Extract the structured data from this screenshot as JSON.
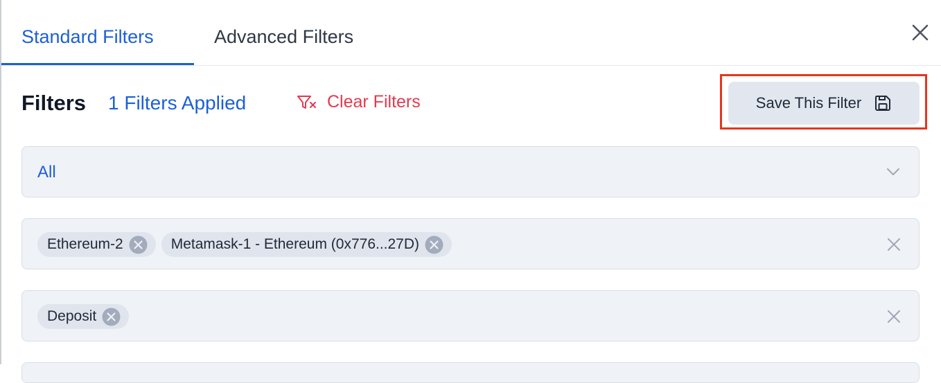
{
  "tabs": [
    {
      "label": "Standard Filters",
      "active": true
    },
    {
      "label": "Advanced Filters",
      "active": false
    }
  ],
  "header": {
    "title": "Filters",
    "applied": "1 Filters Applied",
    "clear_label": "Clear Filters",
    "save_label": "Save This Filter"
  },
  "select": {
    "value": "All"
  },
  "filter_rows": [
    {
      "chips": [
        "Ethereum-2",
        "Metamask-1 - Ethereum (0x776...27D)"
      ]
    },
    {
      "chips": [
        "Deposit"
      ]
    }
  ],
  "icons": {
    "close": "close-icon",
    "clear": "filter-clear-icon",
    "save": "floppy-disk-icon",
    "chevron": "chevron-down-icon",
    "chip_remove": "circle-x-icon",
    "row_clear": "x-icon"
  },
  "colors": {
    "accent": "#1d5fd6",
    "danger": "#e23a4e",
    "highlight": "#e8341c",
    "field_bg": "#eff2f6"
  }
}
